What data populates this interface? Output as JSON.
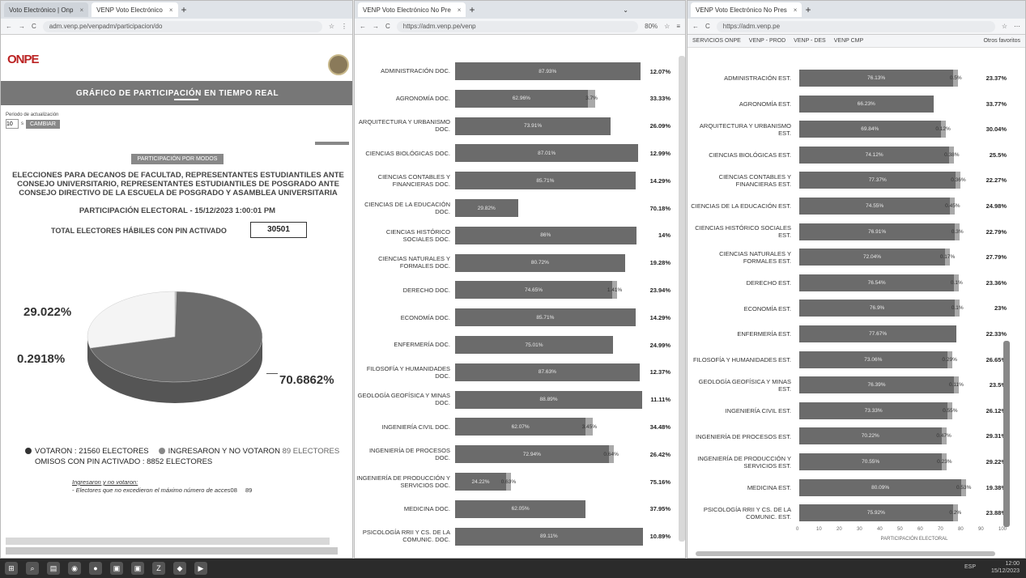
{
  "window1": {
    "tabs": [
      {
        "label": "Voto Electrónico | Onp"
      },
      {
        "label": "VENP Voto Electrónico"
      }
    ],
    "url": "adm.venp.pe/venpadm/participacion/do",
    "logo_text": "ONPE",
    "header_title": "GRÁFICO DE PARTICIPACIÓN EN TIEMPO REAL",
    "period_label": "Periodo de actualización",
    "period_value": "10",
    "period_unit": "s",
    "change_button": "CAMBIAR",
    "mode_button": "PARTICIPACIÓN POR MODOS",
    "election_title": "ELECCIONES PARA DECANOS DE FACULTAD, REPRESENTANTES ESTUDIANTILES ANTE CONSEJO UNIVERSITARIO, REPRESENTANTES ESTUDIANTILES DE POSGRADO ANTE CONSEJO DIRECTIVO DE LA ESCUELA DE POSGRADO Y ASAMBLEA UNIVERSITARIA",
    "participation_line": "PARTICIPACIÓN ELECTORAL - 15/12/2023 1:00:01 PM",
    "total_label": "TOTAL ELECTORES HÁBILES CON PIN ACTIVADO",
    "total_value": "30501",
    "pie": {
      "labels": [
        "29.022%",
        "0.2918%",
        "70.6862%"
      ],
      "values": [
        29.022,
        0.2918,
        70.6862
      ],
      "colors": [
        "#f4f4f4",
        "#b9b9b9",
        "#6b6b6b"
      ]
    },
    "legend": {
      "voted": "VOTARON : 21560 ELECTORES",
      "entered": "INGRESARON Y NO VOTARON",
      "entered_count": "89 ELECTORES",
      "absent": "OMISOS CON PIN ACTIVADO : 8852 ELECTORES"
    },
    "note_title": "Ingresaron y no votaron:",
    "note_text": "- Electores que no excedieron el máximo número de acces",
    "note_count1": "08",
    "note_count2": "89"
  },
  "window2": {
    "tab": "VENP Voto Electrónico No Pre",
    "url": "https://adm.venp.pe/venp",
    "zoom": "80%",
    "rows": [
      {
        "label": "ADMINISTRACIÓN DOC.",
        "voted": 87.93,
        "voted_text": "87.93%",
        "other": 0,
        "other_text": "",
        "end": "12.07%"
      },
      {
        "label": "AGRONOMÍA DOC.",
        "voted": 62.96,
        "voted_text": "62.96%",
        "other": 3.7,
        "other_text": "3.7%",
        "end": "33.33%"
      },
      {
        "label": "ARQUITECTURA Y URBANISMO DOC.",
        "voted": 73.91,
        "voted_text": "73.91%",
        "other": 0,
        "other_text": "",
        "end": "26.09%"
      },
      {
        "label": "CIENCIAS BIOLÓGICAS DOC.",
        "voted": 87.01,
        "voted_text": "87.01%",
        "other": 0,
        "other_text": "",
        "end": "12.99%"
      },
      {
        "label": "CIENCIAS CONTABLES Y FINANCIERAS DOC.",
        "voted": 85.71,
        "voted_text": "85.71%",
        "other": 0,
        "other_text": "",
        "end": "14.29%"
      },
      {
        "label": "CIENCIAS DE LA EDUCACIÓN DOC.",
        "voted": 29.82,
        "voted_text": "29.82%",
        "other": 0,
        "other_text": "",
        "end": "70.18%"
      },
      {
        "label": "CIENCIAS HISTÓRICO SOCIALES DOC.",
        "voted": 86,
        "voted_text": "86%",
        "other": 0,
        "other_text": "",
        "end": "14%"
      },
      {
        "label": "CIENCIAS NATURALES Y FORMALES DOC.",
        "voted": 80.72,
        "voted_text": "80.72%",
        "other": 0,
        "other_text": "",
        "end": "19.28%"
      },
      {
        "label": "DERECHO DOC.",
        "voted": 74.65,
        "voted_text": "74.65%",
        "other": 1.41,
        "other_text": "1.41%",
        "end": "23.94%"
      },
      {
        "label": "ECONOMÍA DOC.",
        "voted": 85.71,
        "voted_text": "85.71%",
        "other": 0,
        "other_text": "",
        "end": "14.29%"
      },
      {
        "label": "ENFERMERÍA DOC.",
        "voted": 75.01,
        "voted_text": "75.01%",
        "other": 0,
        "other_text": "",
        "end": "24.99%"
      },
      {
        "label": "FILOSOFÍA Y HUMANIDADES DOC.",
        "voted": 87.63,
        "voted_text": "87.63%",
        "other": 0,
        "other_text": "",
        "end": "12.37%"
      },
      {
        "label": "GEOLOGÍA GEOFÍSICA Y MINAS DOC.",
        "voted": 88.89,
        "voted_text": "88.89%",
        "other": 0,
        "other_text": "",
        "end": "11.11%"
      },
      {
        "label": "INGENIERÍA CIVIL DOC.",
        "voted": 62.07,
        "voted_text": "62.07%",
        "other": 3.45,
        "other_text": "3.45%",
        "end": "34.48%"
      },
      {
        "label": "INGENIERÍA DE PROCESOS DOC.",
        "voted": 72.94,
        "voted_text": "72.94%",
        "other": 0.64,
        "other_text": "0.64%",
        "end": "26.42%"
      },
      {
        "label": "INGENIERÍA DE PRODUCCIÓN Y SERVICIOS DOC.",
        "voted": 24.22,
        "voted_text": "24.22%",
        "other": 0.63,
        "other_text": "0.63%",
        "end": "75.16%"
      },
      {
        "label": "MEDICINA DOC.",
        "voted": 62.05,
        "voted_text": "62.05%",
        "other": 0,
        "other_text": "",
        "end": "37.95%"
      },
      {
        "label": "PSICOLOGÍA RRII Y CS. DE LA COMUNIC. DOC.",
        "voted": 89.11,
        "voted_text": "89.11%",
        "other": 0,
        "other_text": "",
        "end": "10.89%"
      }
    ]
  },
  "window3": {
    "tab": "VENP Voto Electrónico No Pres",
    "url": "https://adm.venp.pe",
    "bookmarks": [
      "SERVICIOS ONPE",
      "VENP - PROD",
      "VENP - DES",
      "VENP CMP",
      "Otros favoritos"
    ],
    "axis_ticks": [
      "0",
      "10",
      "20",
      "30",
      "40",
      "50",
      "60",
      "70",
      "80",
      "90",
      "100"
    ],
    "axis_label": "PARTICIPACIÓN ELECTORAL",
    "rows": [
      {
        "label": "ADMINISTRACIÓN EST.",
        "voted": 76.13,
        "voted_text": "76.13%",
        "other": 0.5,
        "other_text": "0.5%",
        "end": "23.37%"
      },
      {
        "label": "AGRONOMÍA EST.",
        "voted": 66.23,
        "voted_text": "66.23%",
        "other": 0,
        "other_text": "",
        "end": "33.77%"
      },
      {
        "label": "ARQUITECTURA Y URBANISMO EST.",
        "voted": 69.84,
        "voted_text": "69.84%",
        "other": 0.12,
        "other_text": "0.12%",
        "end": "30.04%"
      },
      {
        "label": "CIENCIAS BIOLÓGICAS EST.",
        "voted": 74.12,
        "voted_text": "74.12%",
        "other": 0.38,
        "other_text": "0.38%",
        "end": "25.5%"
      },
      {
        "label": "CIENCIAS CONTABLES Y FINANCIERAS EST.",
        "voted": 77.37,
        "voted_text": "77.37%",
        "other": 0.36,
        "other_text": "0.36%",
        "end": "22.27%"
      },
      {
        "label": "CIENCIAS DE LA EDUCACIÓN EST.",
        "voted": 74.55,
        "voted_text": "74.55%",
        "other": 0.45,
        "other_text": "0.45%",
        "end": "24.98%"
      },
      {
        "label": "CIENCIAS HISTÓRICO SOCIALES EST.",
        "voted": 76.91,
        "voted_text": "76.91%",
        "other": 0.3,
        "other_text": "0.3%",
        "end": "22.79%"
      },
      {
        "label": "CIENCIAS NATURALES Y FORMALES EST.",
        "voted": 72.04,
        "voted_text": "72.04%",
        "other": 0.17,
        "other_text": "0.17%",
        "end": "27.79%"
      },
      {
        "label": "DERECHO EST.",
        "voted": 76.54,
        "voted_text": "76.54%",
        "other": 0.1,
        "other_text": "0.1%",
        "end": "23.36%"
      },
      {
        "label": "ECONOMÍA EST.",
        "voted": 76.9,
        "voted_text": "76.9%",
        "other": 0.1,
        "other_text": "0.1%",
        "end": "23%"
      },
      {
        "label": "ENFERMERÍA EST.",
        "voted": 77.67,
        "voted_text": "77.67%",
        "other": 0,
        "other_text": "",
        "end": "22.33%"
      },
      {
        "label": "FILOSOFÍA Y HUMANIDADES EST.",
        "voted": 73.06,
        "voted_text": "73.06%",
        "other": 0.29,
        "other_text": "0.29%",
        "end": "26.65%"
      },
      {
        "label": "GEOLOGÍA GEOFÍSICA Y MINAS EST.",
        "voted": 76.39,
        "voted_text": "76.39%",
        "other": 0.11,
        "other_text": "0.11%",
        "end": "23.5%"
      },
      {
        "label": "INGENIERÍA CIVIL EST.",
        "voted": 73.33,
        "voted_text": "73.33%",
        "other": 0.55,
        "other_text": "0.55%",
        "end": "26.12%"
      },
      {
        "label": "INGENIERÍA DE PROCESOS EST.",
        "voted": 70.22,
        "voted_text": "70.22%",
        "other": 0.47,
        "other_text": "0.47%",
        "end": "29.31%"
      },
      {
        "label": "INGENIERÍA DE PRODUCCIÓN Y SERVICIOS EST.",
        "voted": 70.55,
        "voted_text": "70.55%",
        "other": 0.23,
        "other_text": "0.23%",
        "end": "29.22%"
      },
      {
        "label": "MEDICINA EST.",
        "voted": 80.09,
        "voted_text": "80.09%",
        "other": 0.53,
        "other_text": "0.53%",
        "end": "19.38%"
      },
      {
        "label": "PSICOLOGÍA RRII Y CS. DE LA COMUNIC. EST.",
        "voted": 75.92,
        "voted_text": "75.92%",
        "other": 0.2,
        "other_text": "0.2%",
        "end": "23.88%"
      }
    ]
  },
  "taskbar": {
    "time": "12:00",
    "date": "15/12/2023",
    "lang": "ESP"
  }
}
